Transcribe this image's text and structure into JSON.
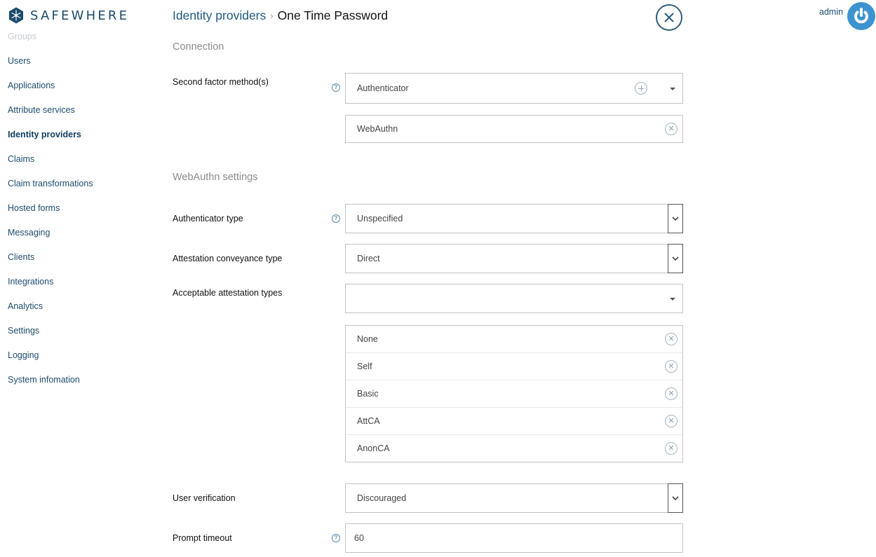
{
  "app": {
    "brand": "SAFEWHERE"
  },
  "sidebar": {
    "items": [
      {
        "label": "Groups",
        "state": "faded"
      },
      {
        "label": "Users"
      },
      {
        "label": "Applications"
      },
      {
        "label": "Attribute services"
      },
      {
        "label": "Identity providers",
        "state": "active"
      },
      {
        "label": "Claims"
      },
      {
        "label": "Claim transformations"
      },
      {
        "label": "Hosted forms"
      },
      {
        "label": "Messaging"
      },
      {
        "label": "Clients"
      },
      {
        "label": "Integrations"
      },
      {
        "label": "Analytics"
      },
      {
        "label": "Settings"
      },
      {
        "label": "Logging"
      },
      {
        "label": "System infomation"
      }
    ]
  },
  "header": {
    "breadcrumb_parent": "Identity providers",
    "breadcrumb_separator": "›",
    "breadcrumb_current": "One Time Password",
    "close_icon": "close-icon",
    "user_name": "admin",
    "power_icon": "power-icon"
  },
  "connection": {
    "section_title": "Connection",
    "second_factor": {
      "label": "Second factor method(s)",
      "help": "?",
      "selector_value": "Authenticator",
      "selected": [
        "WebAuthn"
      ]
    }
  },
  "webauthn": {
    "section_title": "WebAuthn settings",
    "authenticator_type": {
      "label": "Authenticator type",
      "help": "?",
      "value": "Unspecified"
    },
    "attestation_conveyance": {
      "label": "Attestation conveyance type",
      "value": "Direct"
    },
    "acceptable_attestation": {
      "label": "Acceptable attestation types",
      "selector_value": "",
      "selected": [
        "None",
        "Self",
        "Basic",
        "AttCA",
        "AnonCA"
      ]
    },
    "user_verification": {
      "label": "User verification",
      "value": "Discouraged"
    },
    "prompt_timeout": {
      "label": "Prompt timeout",
      "help": "?",
      "value": "60"
    }
  },
  "colors": {
    "brand": "#1b4a6b",
    "link": "#1d5a82",
    "avatar": "#3c93cf"
  }
}
